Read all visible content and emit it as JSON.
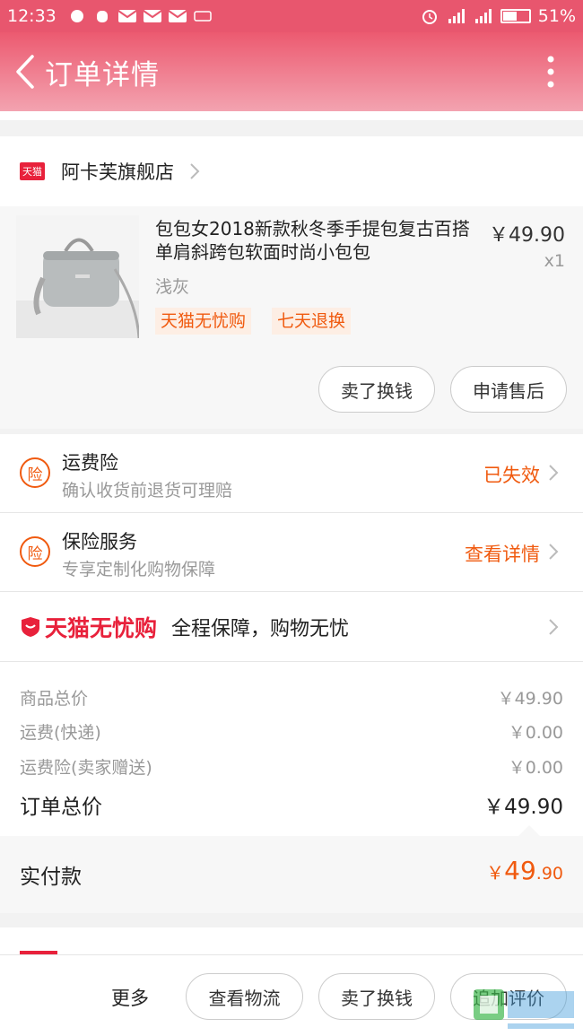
{
  "status_bar": {
    "time": "12:33",
    "battery": "51%"
  },
  "header": {
    "title": "订单详情",
    "back_icon": "chevron-left-icon",
    "more_icon": "more-vertical-icon"
  },
  "shop": {
    "badge": "天猫",
    "name": "阿卡芙旗舰店"
  },
  "product": {
    "title": "包包女2018新款秋冬季手提包复古百搭单肩斜跨包软面时尚小包包",
    "price": "￥49.90",
    "qty": "x1",
    "sku": "浅灰",
    "tags": [
      "天猫无忧购",
      "七天退换"
    ],
    "buttons": [
      "卖了换钱",
      "申请售后"
    ]
  },
  "insurance": [
    {
      "icon": "险",
      "title": "运费险",
      "subtitle": "确认收货前退货可理赔",
      "status": "已失效"
    },
    {
      "icon": "险",
      "title": "保险服务",
      "subtitle": "专享定制化购物保障",
      "status": "查看详情"
    }
  ],
  "worry_free": {
    "brand": "天猫无忧购",
    "text": "全程保障，购物无忧"
  },
  "prices": {
    "items": [
      {
        "label": "商品总价",
        "value": "￥49.90"
      },
      {
        "label": "运费(快递)",
        "value": "￥0.00"
      },
      {
        "label": "运费险(卖家赠送)",
        "value": "￥0.00"
      }
    ],
    "total_label": "订单总价",
    "total_value": "￥49.90",
    "paid_label": "实付款",
    "paid_symbol": "￥",
    "paid_int": "49",
    "paid_dec": ".90"
  },
  "bottom_bar": {
    "more": "更多",
    "buttons": [
      "查看物流",
      "卖了换钱",
      "追加评价"
    ]
  },
  "colors": {
    "accent": "#f05a0f",
    "brand_red": "#e8213b",
    "header": "#ec5a70"
  }
}
